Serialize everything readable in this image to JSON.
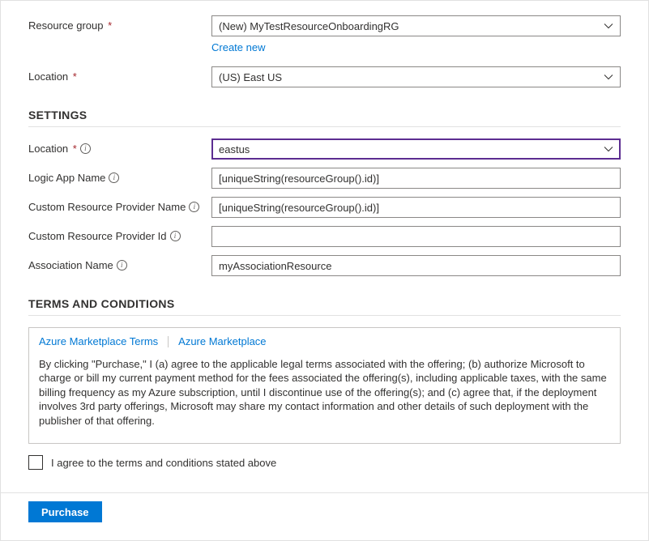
{
  "basics": {
    "resource_group": {
      "label": "Resource group",
      "value": "(New) MyTestResourceOnboardingRG",
      "create_new_label": "Create new"
    },
    "location": {
      "label": "Location",
      "value": "(US) East US"
    }
  },
  "settings": {
    "heading": "SETTINGS",
    "location": {
      "label": "Location",
      "value": "eastus"
    },
    "logic_app_name": {
      "label": "Logic App Name",
      "value": "[uniqueString(resourceGroup().id)]"
    },
    "custom_provider_name": {
      "label": "Custom Resource Provider Name",
      "value": "[uniqueString(resourceGroup().id)]"
    },
    "custom_provider_id": {
      "label": "Custom Resource Provider Id",
      "value": ""
    },
    "association_name": {
      "label": "Association Name",
      "value": "myAssociationResource"
    }
  },
  "terms": {
    "heading": "TERMS AND CONDITIONS",
    "link1": "Azure Marketplace Terms",
    "link2": "Azure Marketplace",
    "body": "By clicking \"Purchase,\" I (a) agree to the applicable legal terms associated with the offering; (b) authorize Microsoft to charge or bill my current payment method for the fees associated the offering(s), including applicable taxes, with the same billing frequency as my Azure subscription, until I discontinue use of the offering(s); and (c) agree that, if the deployment involves 3rd party offerings, Microsoft may share my contact information and other details of such deployment with the publisher of that offering.",
    "agree_label": "I agree to the terms and conditions stated above"
  },
  "footer": {
    "purchase_label": "Purchase"
  }
}
